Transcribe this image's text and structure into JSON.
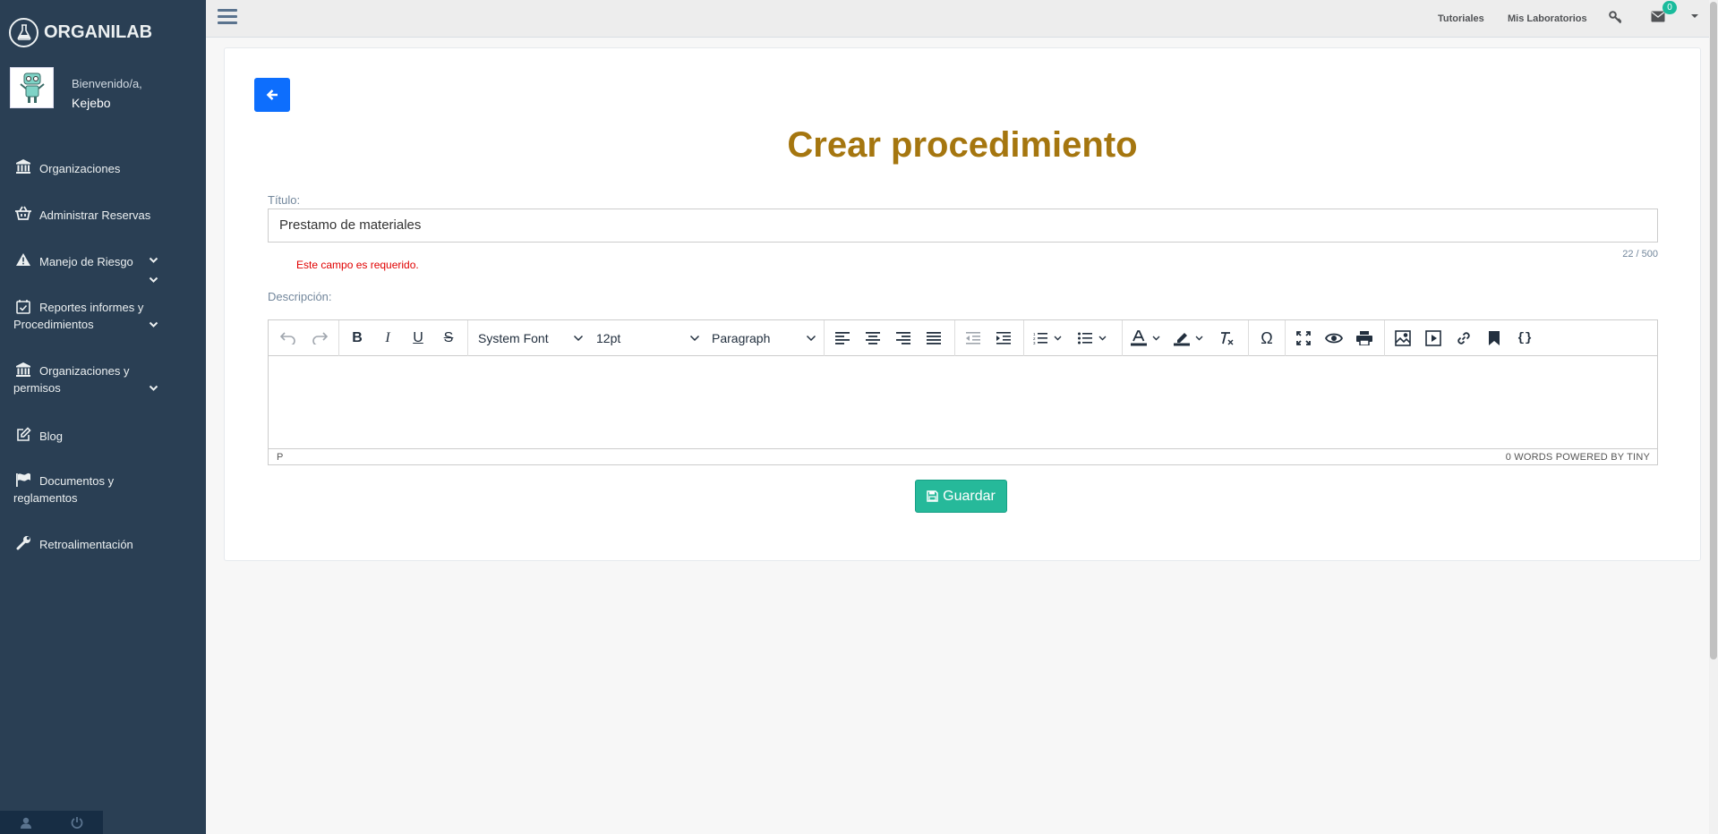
{
  "app": {
    "name": "ORGANILAB"
  },
  "profile": {
    "welcome": "Bienvenido/a,",
    "username": "Kejebo"
  },
  "sidebar": {
    "items": [
      {
        "label": "Organizaciones",
        "icon": "institution-icon",
        "has_submenu": false
      },
      {
        "label": "Administrar Reservas",
        "icon": "basket-icon",
        "has_submenu": true
      },
      {
        "label": "Manejo de Riesgo",
        "icon": "warning-icon",
        "has_submenu": true
      },
      {
        "label": "Reportes informes y Procedimientos",
        "icon": "calendar-check-icon",
        "has_submenu": true
      },
      {
        "label": "Organizaciones y permisos",
        "icon": "institution-icon",
        "has_submenu": true
      },
      {
        "label": "Blog",
        "icon": "edit-icon",
        "has_submenu": false
      },
      {
        "label": "Documentos y reglamentos",
        "icon": "flag-icon",
        "has_submenu": false
      },
      {
        "label": "Retroalimentación",
        "icon": "wrench-icon",
        "has_submenu": false
      }
    ],
    "footer": [
      "user-icon",
      "power-icon"
    ]
  },
  "topbar": {
    "tutorials": "Tutoriales",
    "labs": "Mis Laboratorios",
    "mail_count": "0"
  },
  "page": {
    "title": "Crear procedimiento",
    "title_label": "Título:",
    "title_value": "Prestamo de materiales",
    "counter": "22 / 500",
    "error": "Este campo es requerido.",
    "description_label": "Descripción:",
    "save_label": "Guardar"
  },
  "editor": {
    "font_family": "System Font",
    "font_size": "12pt",
    "block_format": "Paragraph",
    "status_path": "P",
    "status_right": "0 WORDS  POWERED BY TINY"
  },
  "colors": {
    "sidebar": "#2a3f54",
    "title": "#a5760f",
    "primary": "#0d6efd",
    "success": "#26b99a",
    "error": "#e00000"
  }
}
